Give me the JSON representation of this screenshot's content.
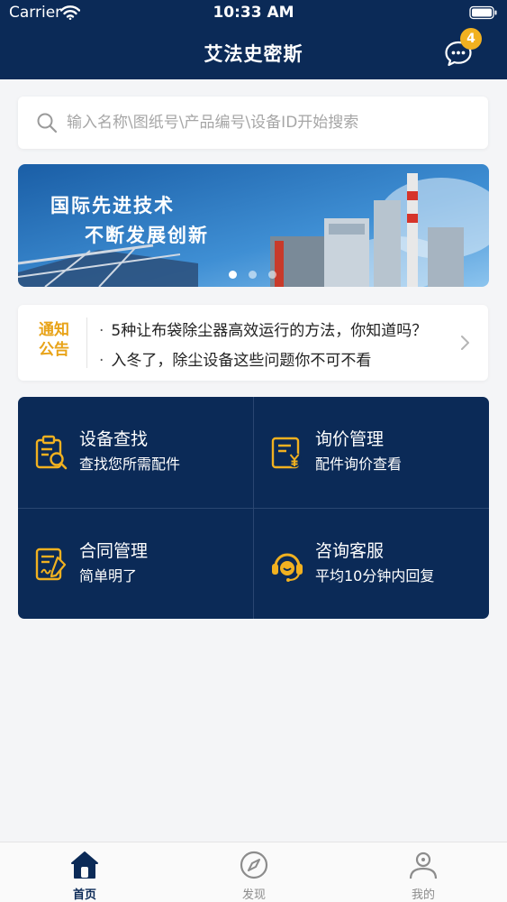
{
  "status_bar": {
    "carrier": "Carrier",
    "time": "10:33 AM"
  },
  "header": {
    "title": "艾法史密斯",
    "message_icon": "chat-bubble-icon",
    "badge_count": "4"
  },
  "search": {
    "placeholder": "输入名称\\图纸号\\产品编号\\设备ID开始搜索",
    "icon": "search-icon"
  },
  "banner": {
    "line1": "国际先进技术",
    "line2": "不断发展创新",
    "page_count": 3,
    "active_page": 1
  },
  "notice": {
    "label": "通知公告",
    "items": [
      "5种让布袋除尘器高效运行的方法，你知道吗？",
      "入冬了，除尘设备这些问题你不可不看"
    ]
  },
  "services": [
    {
      "title": "设备查找",
      "subtitle": "查找您所需配件",
      "icon": "equipment-search-icon"
    },
    {
      "title": "询价管理",
      "subtitle": "配件询价查看",
      "icon": "price-inquiry-icon"
    },
    {
      "title": "合同管理",
      "subtitle": "简单明了",
      "icon": "contract-icon"
    },
    {
      "title": "咨询客服",
      "subtitle": "平均10分钟内回复",
      "icon": "customer-service-icon"
    }
  ],
  "tabs": [
    {
      "label": "首页",
      "icon": "home-icon",
      "active": true
    },
    {
      "label": "发现",
      "icon": "compass-icon",
      "active": false
    },
    {
      "label": "我的",
      "icon": "profile-icon",
      "active": false
    }
  ],
  "colors": {
    "primary": "#0b2a57",
    "accent": "#f1b120",
    "notice_label": "#e8a318"
  }
}
